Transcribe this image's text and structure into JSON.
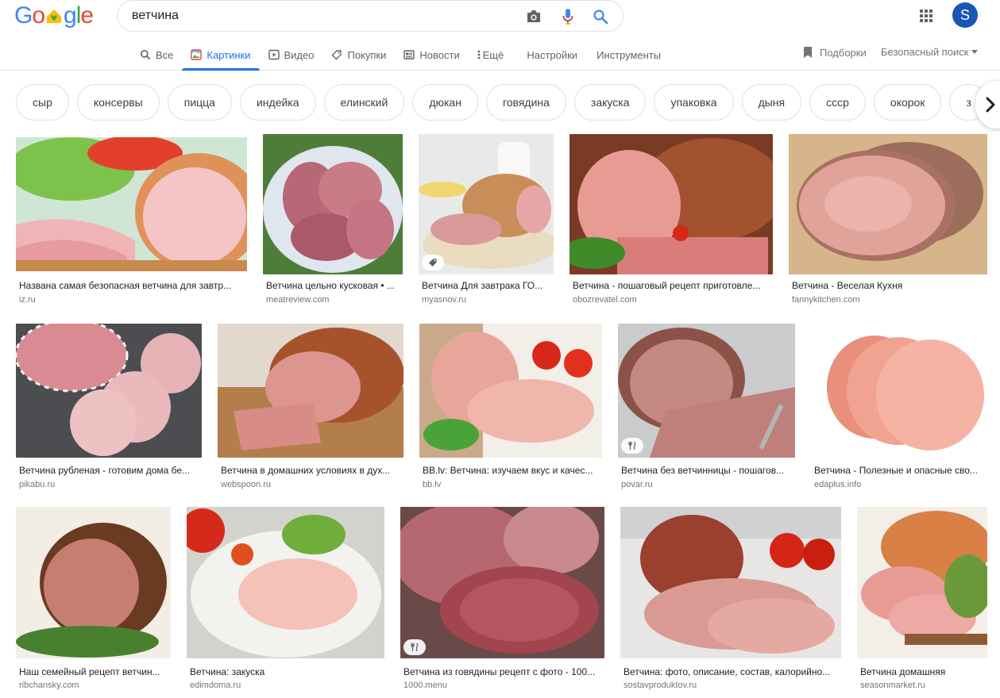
{
  "search": {
    "query": "ветчина"
  },
  "account": {
    "initial": "S"
  },
  "tabs": [
    {
      "label": "Все",
      "icon": "search-icon"
    },
    {
      "label": "Картинки",
      "icon": "image-icon",
      "active": true
    },
    {
      "label": "Видео",
      "icon": "video-icon"
    },
    {
      "label": "Покупки",
      "icon": "tag-icon"
    },
    {
      "label": "Новости",
      "icon": "news-icon"
    },
    {
      "label": "Ещё",
      "icon": "more-vert-icon"
    },
    {
      "label": "Настройки"
    },
    {
      "label": "Инструменты"
    }
  ],
  "tools": {
    "collections": "Подборки",
    "safesearch": "Безопасный поиск"
  },
  "chips": [
    "сыр",
    "консервы",
    "пицца",
    "индейка",
    "елинский",
    "дюкан",
    "говядина",
    "закуска",
    "упаковка",
    "дыня",
    "ссср",
    "окорок",
    "з"
  ],
  "results": [
    {
      "title": "Названа самая безопасная ветчина для завтр...",
      "site": "iz.ru"
    },
    {
      "title": "Ветчина цельно кусковая • ...",
      "site": "meatreview.com"
    },
    {
      "title": "Ветчина Для завтрака ГО...",
      "site": "myasnov.ru",
      "badge": "tag-icon"
    },
    {
      "title": "Ветчина - пошаговый рецепт приготовле...",
      "site": "obozrevatel.com"
    },
    {
      "title": "Ветчина - Веселая Кухня",
      "site": "fannykitchen.com"
    },
    {
      "title": "Ветчина рубленая - готовим дома бе...",
      "site": "pikabu.ru"
    },
    {
      "title": "Ветчина в домашних условиях в дух...",
      "site": "webspoon.ru"
    },
    {
      "title": "BB.lv: Ветчина: изучаем вкус и качес...",
      "site": "bb.lv"
    },
    {
      "title": "Ветчина без ветчинницы - пошагов...",
      "site": "povar.ru",
      "badge": "fork-knife-icon"
    },
    {
      "title": "Ветчина - Полезные и опасные сво...",
      "site": "edaplus.info"
    },
    {
      "title": "Наш семейный рецепт ветчин...",
      "site": "ribchansky.com"
    },
    {
      "title": "Ветчина: закуска",
      "site": "edimdoma.ru"
    },
    {
      "title": "Ветчина из говядины рецепт с фото - 100...",
      "site": "1000.menu",
      "badge": "fork-knife-icon"
    },
    {
      "title": "Ветчина: фото, описание, состав, калорийно...",
      "site": "sostavproduktov.ru"
    },
    {
      "title": "Ветчина домашняя",
      "site": "seasonmarket.ru"
    }
  ],
  "colors": {
    "accent": "#1a73e8",
    "avatar": "#1a56b5"
  }
}
